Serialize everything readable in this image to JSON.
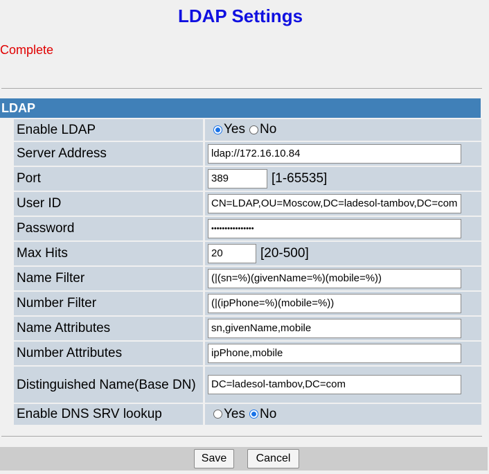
{
  "page": {
    "title": "LDAP Settings",
    "status": "Complete"
  },
  "section": {
    "header": "LDAP"
  },
  "fields": {
    "enable_ldap": {
      "label": "Enable LDAP",
      "options": [
        "Yes",
        "No"
      ],
      "selected": "Yes"
    },
    "server_address": {
      "label": "Server Address",
      "value": "ldap://172.16.10.84"
    },
    "port": {
      "label": "Port",
      "value": "389",
      "range": "[1-65535]"
    },
    "user_id": {
      "label": "User ID",
      "value": "CN=LDAP,OU=Moscow,DC=ladesol-tambov,DC=com"
    },
    "password": {
      "label": "Password",
      "value": "••••••••••••••••"
    },
    "max_hits": {
      "label": "Max Hits",
      "value": "20",
      "range": "[20-500]"
    },
    "name_filter": {
      "label": "Name Filter",
      "value": "(|(sn=%)(givenName=%)(mobile=%))"
    },
    "number_filter": {
      "label": "Number Filter",
      "value": "(|(ipPhone=%)(mobile=%))"
    },
    "name_attributes": {
      "label": "Name Attributes",
      "value": "sn,givenName,mobile"
    },
    "number_attributes": {
      "label": "Number Attributes",
      "value": "ipPhone,mobile"
    },
    "base_dn": {
      "label": "Distinguished Name(Base DN)",
      "value": "DC=ladesol-tambov,DC=com"
    },
    "dns_srv": {
      "label": "Enable DNS SRV lookup",
      "options": [
        "Yes",
        "No"
      ],
      "selected": "No"
    }
  },
  "buttons": {
    "save": "Save",
    "cancel": "Cancel"
  },
  "colors": {
    "title": "#1010e0",
    "status": "#e00000",
    "section_header": "#4080b8",
    "row_background": "#ccd6e0",
    "radio_accent": "#1a73e8"
  }
}
